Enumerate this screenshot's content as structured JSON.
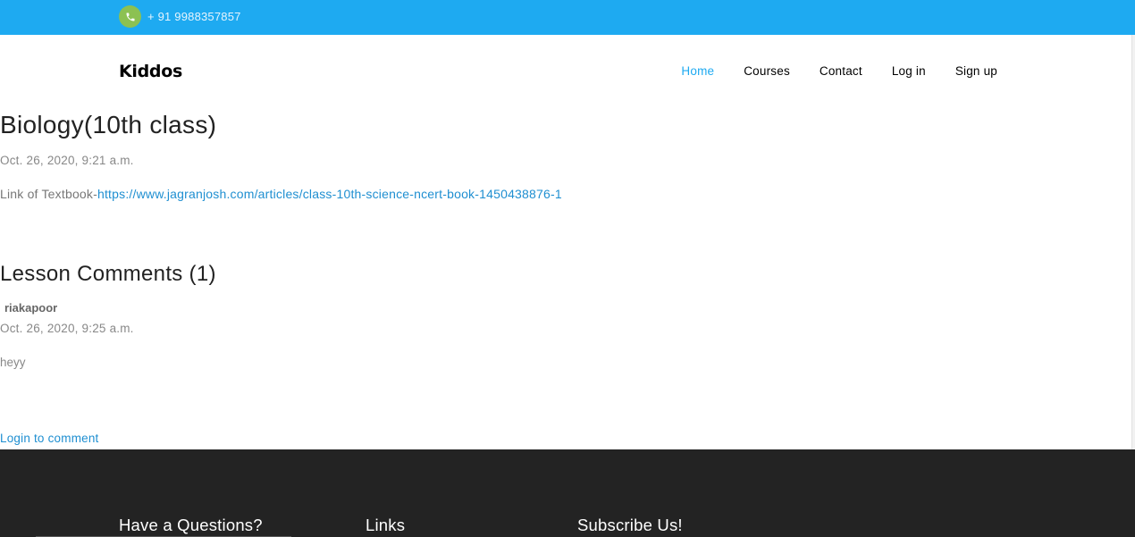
{
  "topbar": {
    "phone_icon": "phone-icon",
    "phone": "+ 91 9988357857",
    "colors": {
      "bar": "#1eaaf1",
      "icon_bg": "#8cc152"
    }
  },
  "navbar": {
    "brand": "Kiddos",
    "items": [
      {
        "label": "Home",
        "active": true
      },
      {
        "label": "Courses",
        "active": false
      },
      {
        "label": "Contact",
        "active": false
      },
      {
        "label": "Log in",
        "active": false
      },
      {
        "label": "Sign up",
        "active": false
      }
    ]
  },
  "lesson": {
    "title": "Biology(10th class)",
    "date": "Oct. 26, 2020, 9:21 a.m.",
    "link_prefix": "Link of Textbook-",
    "link_url": "https://www.jagranjosh.com/articles/class-10th-science-ncert-book-1450438876-1"
  },
  "comments": {
    "heading": "Lesson Comments (1)",
    "items": [
      {
        "author": "riakapoor",
        "date": "Oct. 26, 2020, 9:25 a.m.",
        "text": "heyy"
      }
    ],
    "login_link": "Login to comment"
  },
  "footer": {
    "headings": [
      "Have a Questions?",
      "Links",
      "Subscribe Us!"
    ]
  }
}
